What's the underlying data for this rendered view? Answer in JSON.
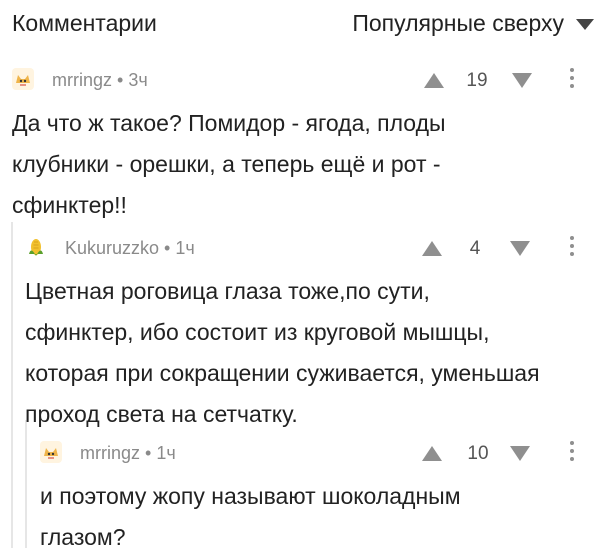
{
  "header": {
    "title": "Комментарии",
    "sort_label": "Популярные сверху"
  },
  "comments": [
    {
      "author": "mrringz",
      "time": "3ч",
      "rating": "19",
      "lines": [
        "Да что ж такое? Помидор - ягода, плоды",
        "клубники - орешки, а теперь ещё и рот -",
        "сфинктер!!"
      ]
    },
    {
      "author": "Kukuruzzko",
      "time": "1ч",
      "rating": "4",
      "lines": [
        "Цветная роговица глаза тоже,по сути,",
        "сфинктер, ибо состоит из круговой мышцы,",
        "которая при сокращении суживается, уменьшая",
        "проход света на сетчатку."
      ]
    },
    {
      "author": "mrringz",
      "time": "1ч",
      "rating": "10",
      "lines": [
        "и поэтому жопу называют шоколадным",
        "глазом?"
      ]
    }
  ],
  "colors": {
    "meta_text": "#8a8a8a",
    "icon_gray": "#8f8f8f",
    "thread_line": "#e6e6e6"
  },
  "icons": {
    "sort": "triangle-down",
    "avatar_mrringz": "cat-face",
    "avatar_kukuruzzko": "corn",
    "vote_up": "triangle-up",
    "vote_down": "triangle-down",
    "more": "vertical-dots"
  }
}
